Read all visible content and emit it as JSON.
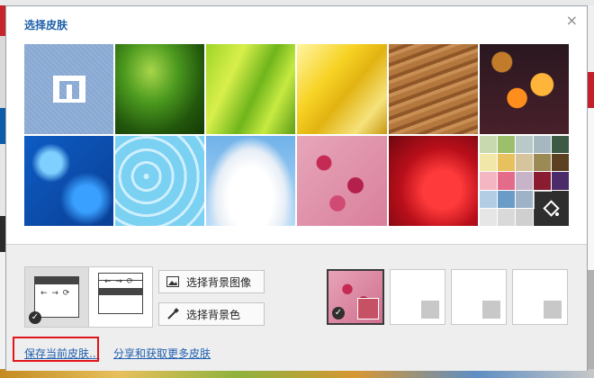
{
  "dialog": {
    "title": "选择皮肤",
    "close_glyph": "×"
  },
  "skins": [
    {
      "name": "maxthon-logo"
    },
    {
      "name": "grass"
    },
    {
      "name": "green-stripes"
    },
    {
      "name": "yellow-leaf"
    },
    {
      "name": "sand-dunes"
    },
    {
      "name": "orange-bokeh"
    },
    {
      "name": "blue-water"
    },
    {
      "name": "cyan-cells"
    },
    {
      "name": "white-clouds"
    },
    {
      "name": "pink-blossom"
    },
    {
      "name": "red-petal"
    },
    {
      "name": "color-palette"
    }
  ],
  "palette_colors": [
    "#c8d9b0",
    "#9bbf6a",
    "#b9c8c9",
    "#a5b7bf",
    "#3d5a45",
    "#f1e7a8",
    "#e7c15d",
    "#d6c49c",
    "#9c8a55",
    "#5b4022",
    "#f3b6c2",
    "#e56b8a",
    "#c8b4c9",
    "#8a1c32",
    "#4b2b6a",
    "#b3cde5",
    "#6b9cc7",
    "#9fb3c8",
    "#c7c7c7",
    "#2f2f2f",
    "#e6e6e6",
    "#d9d9d9",
    "#cfcfcf",
    "#3a3a3a",
    "#2a2a2a"
  ],
  "footer": {
    "buttons": {
      "bg_image": "选择背景图像",
      "bg_color": "选择背景色"
    },
    "links": {
      "save_current": "保存当前皮肤...",
      "share_more": "分享和获取更多皮肤"
    }
  },
  "colors": {
    "accent": "#1c5fa8",
    "link": "#2160b0",
    "highlight": "#e2141c"
  }
}
